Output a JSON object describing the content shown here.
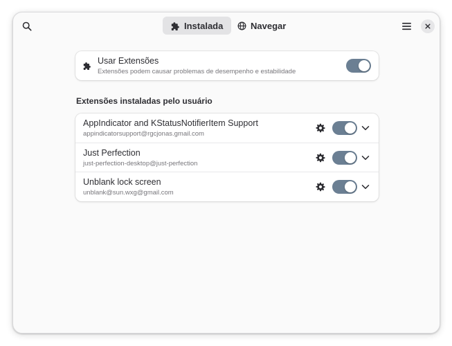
{
  "header": {
    "tabs": [
      {
        "label": "Instalada",
        "icon": "puzzle-icon",
        "active": true
      },
      {
        "label": "Navegar",
        "icon": "globe-icon",
        "active": false
      }
    ],
    "search_icon": "search-icon",
    "menu_icon": "hamburger-menu-icon",
    "close_icon": "close-icon"
  },
  "master": {
    "title": "Usar Extensões",
    "subtitle": "Extensões podem causar problemas de desempenho e estabilidade",
    "enabled": true
  },
  "section": {
    "heading": "Extensões instaladas pelo usuário"
  },
  "extensions": [
    {
      "name": "AppIndicator and KStatusNotifierItem Support",
      "uuid": "appindicatorsupport@rgcjonas.gmail.com",
      "enabled": true
    },
    {
      "name": "Just Perfection",
      "uuid": "just-perfection-desktop@just-perfection",
      "enabled": true
    },
    {
      "name": "Unblank lock screen",
      "uuid": "unblank@sun.wxg@gmail.com",
      "enabled": true
    }
  ],
  "colors": {
    "switch_on": "#6b7f93",
    "window_bg": "#fafafa",
    "card_bg": "#ffffff"
  }
}
